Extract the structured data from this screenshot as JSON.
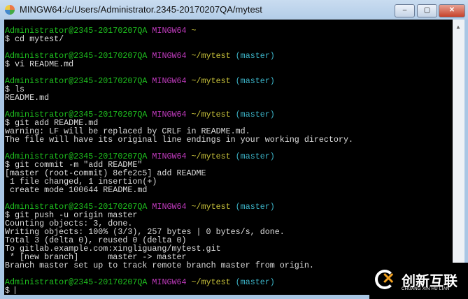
{
  "window": {
    "title": "MINGW64:/c/Users/Administrator.2345-20170207QA/mytest",
    "minimize": "–",
    "maximize": "▢",
    "close": "✕"
  },
  "lines": [
    {
      "type": "prompt",
      "user": "Administrator@2345-20170207QA",
      "sys": "MINGW64",
      "path": "~",
      "branch": ""
    },
    {
      "type": "out",
      "text": "$ cd mytest/"
    },
    {
      "type": "blank"
    },
    {
      "type": "prompt",
      "user": "Administrator@2345-20170207QA",
      "sys": "MINGW64",
      "path": "~/mytest",
      "branch": "(master)"
    },
    {
      "type": "out",
      "text": "$ vi README.md"
    },
    {
      "type": "blank"
    },
    {
      "type": "prompt",
      "user": "Administrator@2345-20170207QA",
      "sys": "MINGW64",
      "path": "~/mytest",
      "branch": "(master)"
    },
    {
      "type": "out",
      "text": "$ ls"
    },
    {
      "type": "out",
      "text": "README.md"
    },
    {
      "type": "blank"
    },
    {
      "type": "prompt",
      "user": "Administrator@2345-20170207QA",
      "sys": "MINGW64",
      "path": "~/mytest",
      "branch": "(master)"
    },
    {
      "type": "out",
      "text": "$ git add README.md"
    },
    {
      "type": "out",
      "text": "warning: LF will be replaced by CRLF in README.md."
    },
    {
      "type": "out",
      "text": "The file will have its original line endings in your working directory."
    },
    {
      "type": "blank"
    },
    {
      "type": "prompt",
      "user": "Administrator@2345-20170207QA",
      "sys": "MINGW64",
      "path": "~/mytest",
      "branch": "(master)"
    },
    {
      "type": "out",
      "text": "$ git commit -m \"add README\""
    },
    {
      "type": "out",
      "text": "[master (root-commit) 8efe2c5] add README"
    },
    {
      "type": "out",
      "text": " 1 file changed, 1 insertion(+)"
    },
    {
      "type": "out",
      "text": " create mode 100644 README.md"
    },
    {
      "type": "blank"
    },
    {
      "type": "prompt",
      "user": "Administrator@2345-20170207QA",
      "sys": "MINGW64",
      "path": "~/mytest",
      "branch": "(master)"
    },
    {
      "type": "out",
      "text": "$ git push -u origin master"
    },
    {
      "type": "out",
      "text": "Counting objects: 3, done."
    },
    {
      "type": "out",
      "text": "Writing objects: 100% (3/3), 257 bytes | 0 bytes/s, done."
    },
    {
      "type": "out",
      "text": "Total 3 (delta 0), reused 0 (delta 0)"
    },
    {
      "type": "out",
      "text": "To gitlab.example.com:xingliguang/mytest.git"
    },
    {
      "type": "out",
      "text": " * [new branch]      master -> master"
    },
    {
      "type": "out",
      "text": "Branch master set up to track remote branch master from origin."
    },
    {
      "type": "blank"
    },
    {
      "type": "prompt",
      "user": "Administrator@2345-20170207QA",
      "sys": "MINGW64",
      "path": "~/mytest",
      "branch": "(master)"
    },
    {
      "type": "input",
      "text": "$ "
    }
  ],
  "watermark": {
    "name": "创新互联",
    "sub": "CHUANG XIN HU LIAN"
  },
  "colors": {
    "user": "#1fc21f",
    "sys": "#c23bbf",
    "path": "#c8c23a",
    "branch": "#3cb4c8"
  }
}
